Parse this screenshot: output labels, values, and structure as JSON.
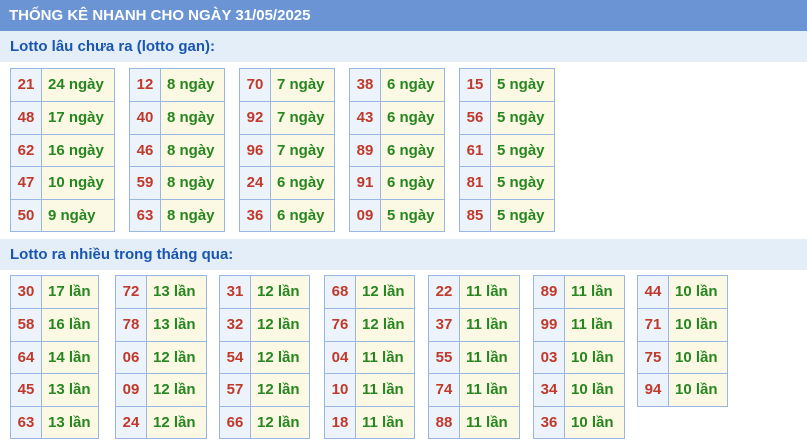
{
  "header": {
    "title": "THỐNG KÊ NHANH CHO NGÀY 31/05/2025"
  },
  "section_gan": {
    "title": "Lotto lâu chưa ra (lotto gan):",
    "groups": [
      [
        {
          "num": "21",
          "val": "24 ngày"
        },
        {
          "num": "48",
          "val": "17 ngày"
        },
        {
          "num": "62",
          "val": "16 ngày"
        },
        {
          "num": "47",
          "val": "10 ngày"
        },
        {
          "num": "50",
          "val": "9 ngày"
        }
      ],
      [
        {
          "num": "12",
          "val": "8 ngày"
        },
        {
          "num": "40",
          "val": "8 ngày"
        },
        {
          "num": "46",
          "val": "8 ngày"
        },
        {
          "num": "59",
          "val": "8 ngày"
        },
        {
          "num": "63",
          "val": "8 ngày"
        }
      ],
      [
        {
          "num": "70",
          "val": "7 ngày"
        },
        {
          "num": "92",
          "val": "7 ngày"
        },
        {
          "num": "96",
          "val": "7 ngày"
        },
        {
          "num": "24",
          "val": "6 ngày"
        },
        {
          "num": "36",
          "val": "6 ngày"
        }
      ],
      [
        {
          "num": "38",
          "val": "6 ngày"
        },
        {
          "num": "43",
          "val": "6 ngày"
        },
        {
          "num": "89",
          "val": "6 ngày"
        },
        {
          "num": "91",
          "val": "6 ngày"
        },
        {
          "num": "09",
          "val": "5 ngày"
        }
      ],
      [
        {
          "num": "15",
          "val": "5 ngày"
        },
        {
          "num": "56",
          "val": "5 ngày"
        },
        {
          "num": "61",
          "val": "5 ngày"
        },
        {
          "num": "81",
          "val": "5 ngày"
        },
        {
          "num": "85",
          "val": "5 ngày"
        }
      ]
    ]
  },
  "section_nhieu": {
    "title": "Lotto ra nhiều trong tháng qua:",
    "groups": [
      [
        {
          "num": "30",
          "val": "17 lần"
        },
        {
          "num": "58",
          "val": "16 lần"
        },
        {
          "num": "64",
          "val": "14 lần"
        },
        {
          "num": "45",
          "val": "13 lần"
        },
        {
          "num": "63",
          "val": "13 lần"
        }
      ],
      [
        {
          "num": "72",
          "val": "13 lần"
        },
        {
          "num": "78",
          "val": "13 lần"
        },
        {
          "num": "06",
          "val": "12 lần"
        },
        {
          "num": "09",
          "val": "12 lần"
        },
        {
          "num": "24",
          "val": "12 lần"
        }
      ],
      [
        {
          "num": "31",
          "val": "12 lần"
        },
        {
          "num": "32",
          "val": "12 lần"
        },
        {
          "num": "54",
          "val": "12 lần"
        },
        {
          "num": "57",
          "val": "12 lần"
        },
        {
          "num": "66",
          "val": "12 lần"
        }
      ],
      [
        {
          "num": "68",
          "val": "12 lần"
        },
        {
          "num": "76",
          "val": "12 lần"
        },
        {
          "num": "04",
          "val": "11 lần"
        },
        {
          "num": "10",
          "val": "11 lần"
        },
        {
          "num": "18",
          "val": "11 lần"
        }
      ],
      [
        {
          "num": "22",
          "val": "11 lần"
        },
        {
          "num": "37",
          "val": "11 lần"
        },
        {
          "num": "55",
          "val": "11 lần"
        },
        {
          "num": "74",
          "val": "11 lần"
        },
        {
          "num": "88",
          "val": "11 lần"
        }
      ],
      [
        {
          "num": "89",
          "val": "11 lần"
        },
        {
          "num": "99",
          "val": "11 lần"
        },
        {
          "num": "03",
          "val": "10 lần"
        },
        {
          "num": "34",
          "val": "10 lần"
        },
        {
          "num": "36",
          "val": "10 lần"
        }
      ],
      [
        {
          "num": "44",
          "val": "10 lần"
        },
        {
          "num": "71",
          "val": "10 lần"
        },
        {
          "num": "75",
          "val": "10 lần"
        },
        {
          "num": "94",
          "val": "10 lần"
        }
      ]
    ]
  }
}
